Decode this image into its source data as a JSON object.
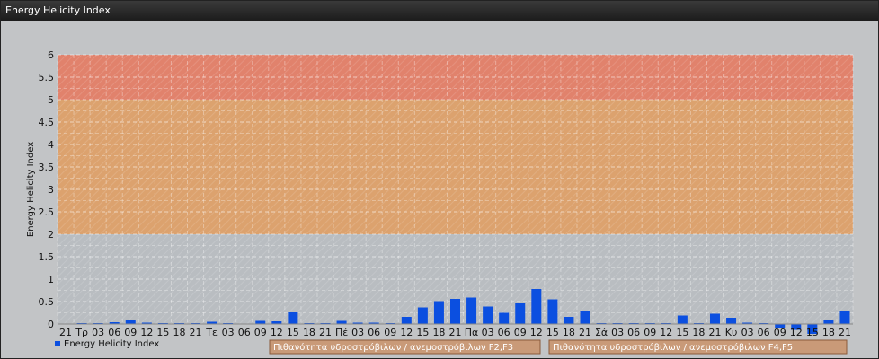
{
  "window": {
    "title": "Energy Helicity Index"
  },
  "colors": {
    "bar": "#0b4fe0",
    "band_low": "#b9bdc1",
    "band_mid": "#dca26e",
    "band_high": "#e1826c",
    "background": "#c2c4c6",
    "legend_box_fill": "#c99a78",
    "legend_box_border": "#8a5a3a"
  },
  "chart_data": {
    "type": "bar",
    "title": "",
    "xlabel": "",
    "ylabel": "Energy Helicity Index",
    "ylim": [
      -0.25,
      6
    ],
    "yticks": [
      "0",
      "0.5",
      "1",
      "1.5",
      "2",
      "2.5",
      "3",
      "3.5",
      "4",
      "4.5",
      "5",
      "5.5",
      "6"
    ],
    "grid": true,
    "legend_position": "bottom-left",
    "bands": [
      {
        "from": 0,
        "to": 2,
        "color": "#b9bdc1"
      },
      {
        "from": 2,
        "to": 5,
        "color": "#dca26e",
        "legend": "Πιθανότητα υδροστρόβιλων / ανεμοστρόβιλων F2,F3"
      },
      {
        "from": 5,
        "to": 6,
        "color": "#e1826c",
        "legend": "Πιθανότητα υδροστρόβιλων / ανεμοστρόβιλων F4,F5"
      }
    ],
    "categories": [
      "21",
      "Τρ",
      "03",
      "06",
      "09",
      "12",
      "15",
      "18",
      "21",
      "Τε",
      "03",
      "06",
      "09",
      "12",
      "15",
      "18",
      "21",
      "Πέ",
      "03",
      "06",
      "09",
      "12",
      "15",
      "18",
      "21",
      "Πα",
      "03",
      "06",
      "09",
      "12",
      "15",
      "18",
      "21",
      "Σά",
      "03",
      "06",
      "09",
      "12",
      "15",
      "18",
      "21",
      "Κυ",
      "03",
      "06",
      "09",
      "12",
      "15",
      "18",
      "21"
    ],
    "series": [
      {
        "name": "Energy Helicity Index",
        "values": [
          0.01,
          0.02,
          0.02,
          0.04,
          0.1,
          0.03,
          0.02,
          0.02,
          0.02,
          0.05,
          0.02,
          0.01,
          0.07,
          0.06,
          0.26,
          0.02,
          0.02,
          0.07,
          0.03,
          0.03,
          0.02,
          0.16,
          0.37,
          0.51,
          0.56,
          0.59,
          0.39,
          0.25,
          0.46,
          0.78,
          0.55,
          0.16,
          0.28,
          0.02,
          0.02,
          0.02,
          0.02,
          0.02,
          0.19,
          0.02,
          0.23,
          0.14,
          0.03,
          0.02,
          -0.08,
          -0.13,
          -0.22,
          0.08,
          0.29
        ]
      }
    ]
  }
}
